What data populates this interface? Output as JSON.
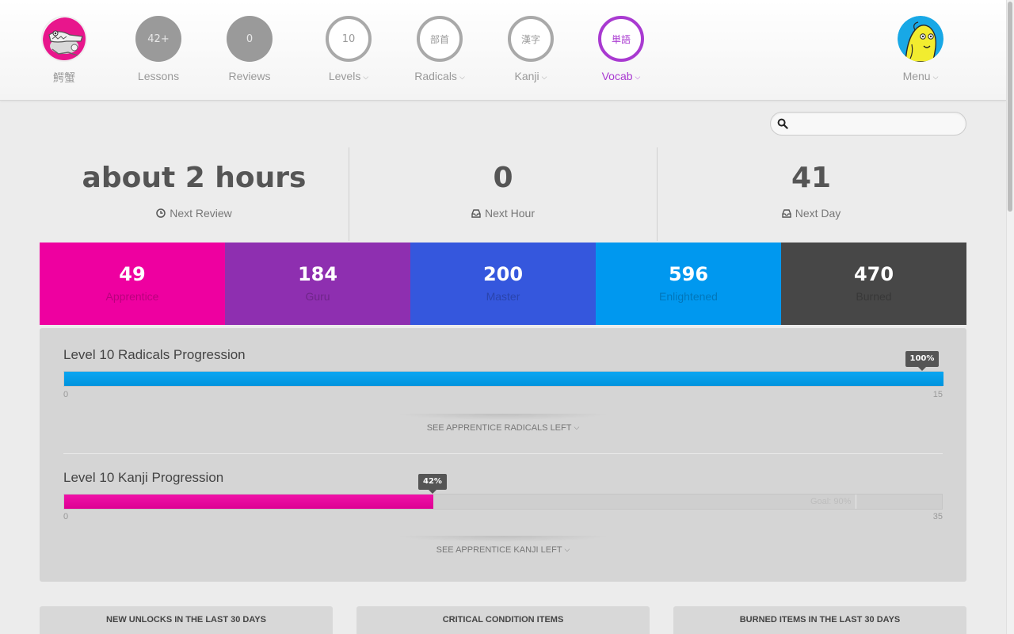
{
  "nav": {
    "user": {
      "label": "鰐蟹"
    },
    "lessons": {
      "count": "42+",
      "label": "Lessons"
    },
    "reviews": {
      "count": "0",
      "label": "Reviews"
    },
    "levels": {
      "glyph": "10",
      "label": "Levels"
    },
    "radicals": {
      "glyph": "部首",
      "label": "Radicals"
    },
    "kanji": {
      "glyph": "漢字",
      "label": "Kanji"
    },
    "vocab": {
      "glyph": "単語",
      "label": "Vocab"
    },
    "menu": {
      "label": "Menu"
    },
    "chevron": "⌄",
    "accent_color": "#a93ad1"
  },
  "search": {
    "placeholder": "",
    "value": ""
  },
  "stats": [
    {
      "value": "about 2 hours",
      "label": "Next Review",
      "icon": "clock-icon"
    },
    {
      "value": "0",
      "label": "Next Hour",
      "icon": "inbox-icon"
    },
    {
      "value": "41",
      "label": "Next Day",
      "icon": "inbox-icon"
    }
  ],
  "srs": [
    {
      "count": "49",
      "label": "Apprentice",
      "color": "#ee00a0"
    },
    {
      "count": "184",
      "label": "Guru",
      "color": "#8e2fb0"
    },
    {
      "count": "200",
      "label": "Master",
      "color": "#3557dd"
    },
    {
      "count": "596",
      "label": "Enlightened",
      "color": "#0098ef"
    },
    {
      "count": "470",
      "label": "Burned",
      "color": "#474747"
    }
  ],
  "progress": {
    "radicals": {
      "title": "Level 10 Radicals Progression",
      "percent_label": "100%",
      "fraction": 1.0,
      "min": "0",
      "max": "15",
      "link": "SEE APPRENTICE RADICALS LEFT"
    },
    "kanji": {
      "title": "Level 10 Kanji Progression",
      "percent_label": "42%",
      "fraction": 0.42,
      "goal_fraction": 0.9,
      "goal_label": "Goal: 90%",
      "min": "0",
      "max": "35",
      "link": "SEE APPRENTICE KANJI LEFT"
    }
  },
  "bottom_panels": [
    "NEW UNLOCKS IN THE LAST 30 DAYS",
    "CRITICAL CONDITION ITEMS",
    "BURNED ITEMS IN THE LAST 30 DAYS"
  ]
}
